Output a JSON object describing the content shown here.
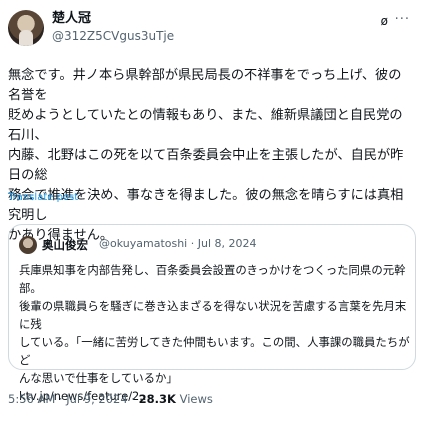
{
  "author": {
    "display_name": "楚人冠",
    "handle": "@312Z5CVgus3uTje"
  },
  "icons": {
    "grok": "grok-icon",
    "more": "more-icon"
  },
  "tweet": {
    "text": "無念です。井ノ本ら県幹部が県民局長の不祥事をでっち上げ、彼の名誉を\n貶めようとしていたとの情報もあり、また、維新県議団と自民党の石川、\n内藤、北野はこの死を以て百条委員会中止を主張したが、自民が昨日の総\n務会で推進を決め、事なきを得ました。彼の無念を晴らすには真相究明し\nかあり得ません。",
    "translate_label": "Translate post"
  },
  "quote": {
    "name": "奥山俊宏",
    "meta": "@okuyamatoshi · Jul 8, 2024",
    "text": "兵庫県知事を内部告発し、百条委員会設置のきっかけをつくった同県の元幹部。\n後輩の県職員らを騒ぎに巻き込まざるを得ない状況を苦慮する言葉を先月末に残\nしている。「一緒に苦労してきた仲間もいます。この間、人事課の職員たちがど\nんな思いで仕事をしているか」",
    "link": "ktv.jp/news/feature/2..."
  },
  "footer": {
    "time": "5:56 AM · Jul 9, 2024 · ",
    "views_count": "28.3K",
    "views_label": " Views"
  }
}
